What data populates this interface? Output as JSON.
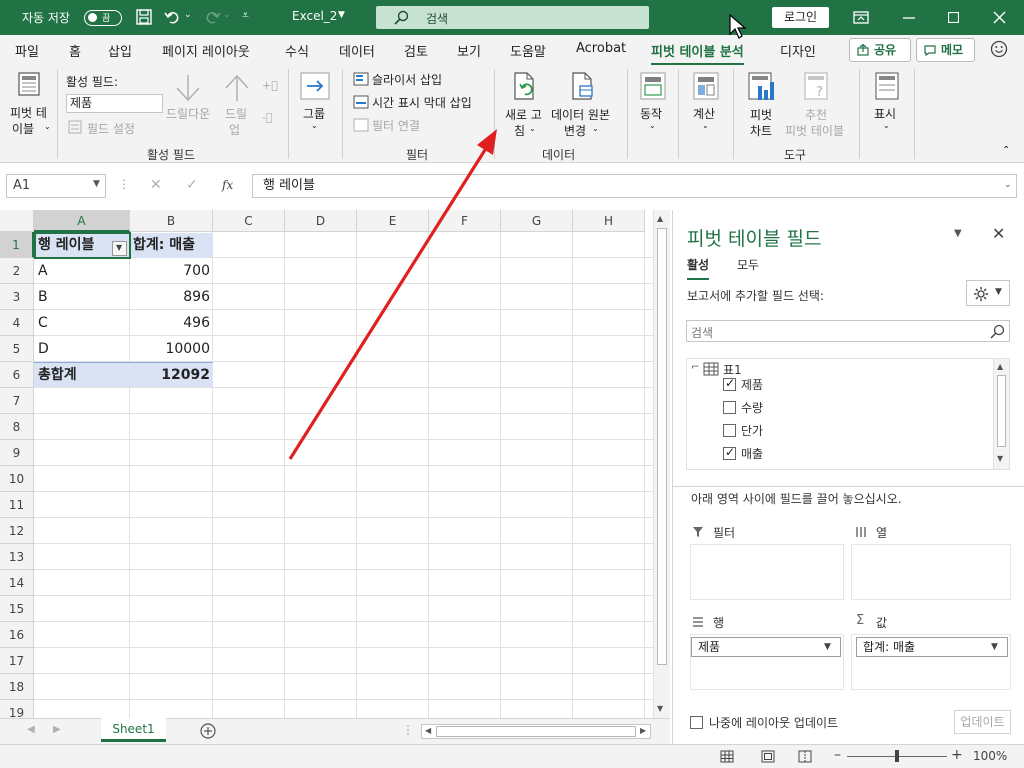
{
  "titlebar": {
    "autosave_label": "자동 저장",
    "autosave_state": "끔",
    "filename": "Excel_2",
    "search_placeholder": "검색",
    "login": "로그인"
  },
  "menu": {
    "tabs": [
      "파일",
      "홈",
      "삽입",
      "페이지 레이아웃",
      "수식",
      "데이터",
      "검토",
      "보기",
      "도움말",
      "Acrobat",
      "피벗 테이블 분석",
      "디자인"
    ],
    "active_tab": "피벗 테이블 분석",
    "share": "공유",
    "memo": "메모"
  },
  "ribbon": {
    "pivot_table_label_1": "피벗 테",
    "pivot_table_label_2": "이블",
    "active_field_label": "활성 필드:",
    "active_field_value": "제품",
    "field_settings": "필드 설정",
    "drilldown": "드릴다운",
    "drillup_1": "드릴",
    "drillup_2": "업",
    "group_label": "그룹",
    "insert_slicer": "슬라이서 삽입",
    "insert_timeline": "시간 표시 막대 삽입",
    "filter_connections": "필터 연결",
    "refresh_1": "새로 고",
    "refresh_2": "침",
    "change_source_1": "데이터 원본",
    "change_source_2": "변경",
    "actions": "동작",
    "calculations": "계산",
    "pivot_chart_1": "피벗",
    "pivot_chart_2": "차트",
    "recommended_1": "추천",
    "recommended_2": "피벗 테이블",
    "show": "표시",
    "groups": {
      "active_field": "활성 필드",
      "filter": "필터",
      "data": "데이터",
      "tools": "도구"
    }
  },
  "formula_bar": {
    "name_box": "A1",
    "fx": "fx",
    "content": "행 레이블"
  },
  "sheet": {
    "columns": [
      "A",
      "B",
      "C",
      "D",
      "E",
      "F",
      "G",
      "H"
    ],
    "rows": [
      "1",
      "2",
      "3",
      "4",
      "5",
      "6",
      "7",
      "8",
      "9",
      "10",
      "11",
      "12",
      "13",
      "14",
      "15",
      "16",
      "17",
      "18",
      "19"
    ],
    "pivot": {
      "header_label": "행 레이블",
      "header_value": "합계: 매출",
      "items": [
        {
          "label": "A",
          "value": "700"
        },
        {
          "label": "B",
          "value": "896"
        },
        {
          "label": "C",
          "value": "496"
        },
        {
          "label": "D",
          "value": "10000"
        }
      ],
      "total_label": "총합계",
      "total_value": "12092"
    },
    "tab_name": "Sheet1"
  },
  "pane": {
    "title": "피벗 테이블 필드",
    "tab_active": "활성",
    "tab_all": "모두",
    "choose_fields": "보고서에 추가할 필드 선택:",
    "search_placeholder": "검색",
    "table_name": "표1",
    "fields": [
      {
        "name": "제품",
        "checked": true
      },
      {
        "name": "수량",
        "checked": false
      },
      {
        "name": "단가",
        "checked": false
      },
      {
        "name": "매출",
        "checked": true
      }
    ],
    "drag_hint": "아래 영역 사이에 필드를 끌어 놓으십시오.",
    "areas": {
      "filters": "필터",
      "columns": "열",
      "rows": "행",
      "values": "값",
      "rows_item": "제품",
      "values_item": "합계: 매출"
    },
    "defer_update": "나중에 레이아웃 업데이트",
    "update_button": "업데이트"
  },
  "status": {
    "zoom": "100%"
  },
  "colors": {
    "excel_green": "#217346",
    "pivot_header_fill": "#dae3f3",
    "arrow_red": "#e02020"
  }
}
